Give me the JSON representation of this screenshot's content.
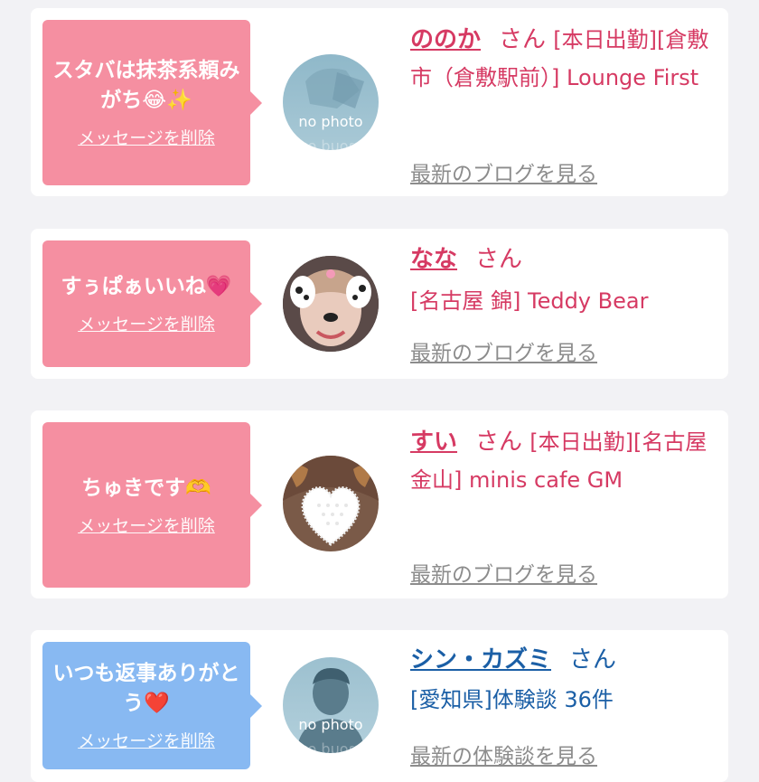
{
  "colors": {
    "pink_bubble": "#f58fa1",
    "blue_bubble": "#88b9f2",
    "pink_text": "#d63a63",
    "blue_text": "#1b5fa6",
    "link_gray": "#8c8c8c"
  },
  "cards": [
    {
      "message": "スタバは抹茶系頼みがち😂✨",
      "delete_label": "メッセージを削除",
      "avatar_type": "no-photo",
      "avatar_label": "no photo",
      "name": "ののか",
      "honorific": "さん",
      "detail": "[本日出勤][倉敷市（倉敷駅前）] Lounge First",
      "link_label": "最新のブログを見る"
    },
    {
      "message": "すぅぱぁいいね💗",
      "delete_label": "メッセージを削除",
      "avatar_type": "photo-dog-filter",
      "name": "なな",
      "honorific": "さん",
      "detail": "[名古屋 錦] Teddy Bear",
      "link_label": "最新のブログを見る"
    },
    {
      "message": "ちゅきです🫶",
      "delete_label": "メッセージを削除",
      "avatar_type": "photo-heart-censored",
      "name": "すい",
      "honorific": "さん",
      "detail": "[本日出勤][名古屋 金山] minis cafe GM",
      "link_label": "最新のブログを見る"
    },
    {
      "message": "いつも返事ありがとう❤️",
      "delete_label": "メッセージを削除",
      "avatar_type": "no-photo-male",
      "avatar_label": "no photo",
      "name": "シン・カズミ",
      "honorific": "さん",
      "detail": "[愛知県]体験談 36件",
      "link_label": "最新の体験談を見る"
    }
  ]
}
